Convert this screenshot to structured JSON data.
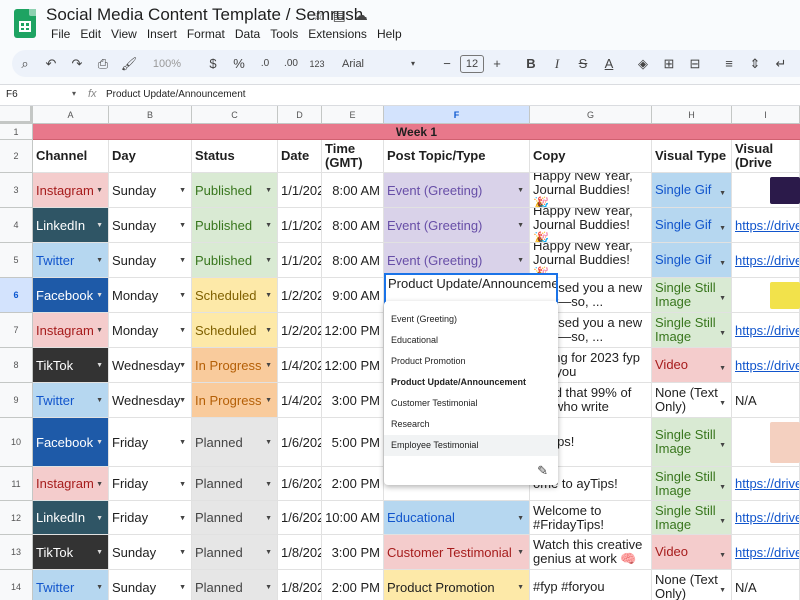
{
  "app": {
    "doc_title": "Social Media Content Template / Semrush",
    "menu": [
      "File",
      "Edit",
      "View",
      "Insert",
      "Format",
      "Data",
      "Tools",
      "Extensions",
      "Help"
    ],
    "zoom": "100%",
    "font": "Arial",
    "font_size": "12",
    "currency": "$",
    "percent": "%",
    "dec_dec": ".0",
    "dec_inc": ".00",
    "num_fmt": "123"
  },
  "formula_bar": {
    "name_box": "F6",
    "fx": "fx",
    "value": "Product Update/Announcement"
  },
  "columns": [
    "A",
    "B",
    "C",
    "D",
    "E",
    "F",
    "G",
    "H",
    "I"
  ],
  "row_numbers": [
    "1",
    "2",
    "3",
    "4",
    "5",
    "6",
    "7",
    "8",
    "9",
    "10",
    "11",
    "12",
    "13",
    "14"
  ],
  "week_label": "Week 1",
  "headers": {
    "channel": "Channel",
    "day": "Day",
    "status": "Status",
    "date": "Date",
    "time": "Time (GMT)",
    "topic": "Post Topic/Type",
    "copy": "Copy",
    "visual_type": "Visual Type",
    "visual_drive": "Visual (Drive"
  },
  "rows": [
    {
      "channel": "Instagram",
      "day": "Sunday",
      "status": "Published",
      "date": "1/1/2023",
      "time": "8:00 AM",
      "topic": "Event (Greeting)",
      "copy": "Happy New Year, Journal Buddies! 🎉",
      "visual_type": "Single Gif",
      "visual": ""
    },
    {
      "channel": "LinkedIn",
      "day": "Sunday",
      "status": "Published",
      "date": "1/1/2023",
      "time": "8:00 AM",
      "topic": "Event (Greeting)",
      "copy": "Happy New Year, Journal Buddies! 🎉",
      "visual_type": "Single Gif",
      "visual": "https://drive."
    },
    {
      "channel": "Twitter",
      "day": "Sunday",
      "status": "Published",
      "date": "1/1/2023",
      "time": "8:00 AM",
      "topic": "Event (Greeting)",
      "copy": "Happy New Year, Journal Buddies! 🎉",
      "visual_type": "Single Gif",
      "visual": "https://drive."
    },
    {
      "channel": "Facebook",
      "day": "Monday",
      "status": "Scheduled",
      "date": "1/2/2023",
      "time": "9:00 AM",
      "topic": "Product Update/Announcement",
      "copy": "romised you a new year—so, ...",
      "visual_type": "Single Still Image",
      "visual": ""
    },
    {
      "channel": "Instagram",
      "day": "Monday",
      "status": "Scheduled",
      "date": "1/2/2023",
      "time": "12:00 PM",
      "topic": "",
      "copy": "romised you a new year—so, ...",
      "visual_type": "Single Still Image",
      "visual": "https://drive."
    },
    {
      "channel": "TikTok",
      "day": "Wednesday",
      "status": "In Progress",
      "date": "1/4/2023",
      "time": "12:00 PM",
      "topic": "",
      "copy": "naling for 2023 fyp #foryou",
      "visual_type": "Video",
      "visual": "https://drive."
    },
    {
      "channel": "Twitter",
      "day": "Wednesday",
      "status": "In Progress",
      "date": "1/4/2023",
      "time": "3:00 PM",
      "topic": "",
      "copy": "ound that 99% of ole who write",
      "visual_type": "None (Text Only)",
      "visual": "N/A"
    },
    {
      "channel": "Facebook",
      "day": "Friday",
      "status": "Planned",
      "date": "1/6/2023",
      "time": "5:00 PM",
      "topic": "",
      "copy": "ayTips!",
      "visual_type": "Single Still Image",
      "visual": ""
    },
    {
      "channel": "Instagram",
      "day": "Friday",
      "status": "Planned",
      "date": "1/6/2023",
      "time": "2:00 PM",
      "topic": "",
      "copy": "ome to ayTips!",
      "visual_type": "Single Still Image",
      "visual": "https://drive."
    },
    {
      "channel": "LinkedIn",
      "day": "Friday",
      "status": "Planned",
      "date": "1/6/2023",
      "time": "10:00 AM",
      "topic": "Educational",
      "copy": "Welcome to #FridayTips!",
      "visual_type": "Single Still Image",
      "visual": "https://drive."
    },
    {
      "channel": "TikTok",
      "day": "Sunday",
      "status": "Planned",
      "date": "1/8/2023",
      "time": "3:00 PM",
      "topic": "Customer Testimonial",
      "copy": "Watch this creative genius at work 🧠",
      "visual_type": "Video",
      "visual": "https://drive."
    },
    {
      "channel": "Twitter",
      "day": "Sunday",
      "status": "Planned",
      "date": "1/8/2023",
      "time": "2:00 PM",
      "topic": "Product Promotion",
      "copy": "#fyp #foryou",
      "visual_type": "None (Text Only)",
      "visual": "N/A"
    }
  ],
  "dropdown": {
    "editing_value": "Product Update/Announcement",
    "options": [
      "Event (Greeting)",
      "Educational",
      "Product Promotion",
      "Product Update/Announcement",
      "Customer Testimonial",
      "Research",
      "Employee Testimonial"
    ],
    "selected": "Product Update/Announcement",
    "hovered": "Employee Testimonial"
  },
  "colors": {
    "Instagram": "#f4cccc",
    "LinkedIn": "#2f5565",
    "Twitter": "#b6d7f0",
    "Facebook": "#1e5aa8",
    "TikTok": "#333333",
    "Published": "#d9ead3",
    "Scheduled": "#fde9a8",
    "In Progress": "#f9cb9c",
    "Planned": "#e6e6e6",
    "Event (Greeting)": "#d9d2e9",
    "Educational": "#b6d7f0",
    "Customer Testimonial": "#f4cccc",
    "Product Promotion": "#fde9a8",
    "Single Gif": "#b6d7f0",
    "Single Still Image": "#d9ead3",
    "Video": "#f4cccc"
  }
}
